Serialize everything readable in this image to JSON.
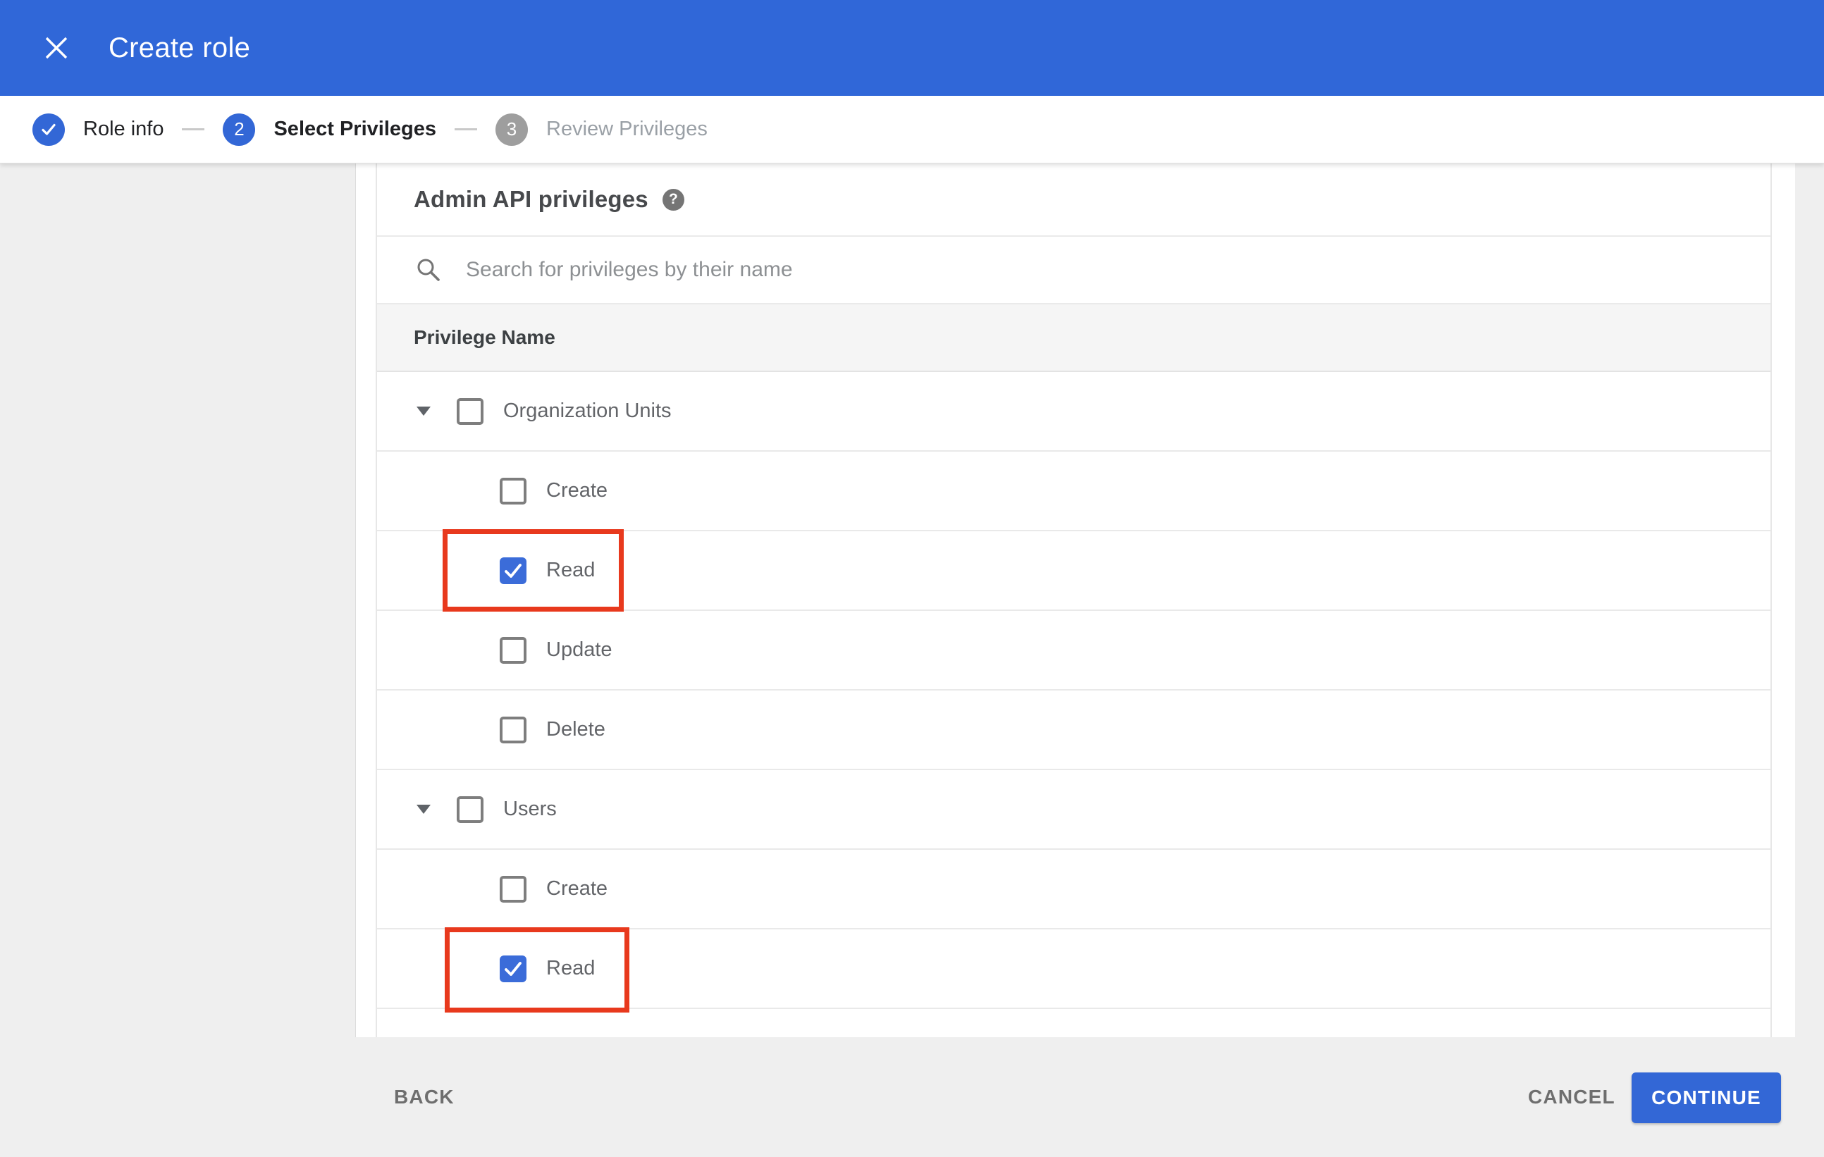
{
  "app_bar": {
    "title": "Create role",
    "close_icon": "close-icon",
    "bg_color": "#3067d8"
  },
  "stepper": {
    "steps": [
      {
        "label": "Role info",
        "indicator": "check",
        "status": "completed"
      },
      {
        "label": "Select Privileges",
        "indicator": "2",
        "status": "active"
      },
      {
        "label": "Review Privileges",
        "indicator": "3",
        "status": "upcoming"
      }
    ]
  },
  "main": {
    "section_title": "Admin API privileges",
    "help_icon": "help-icon",
    "search": {
      "icon": "search-icon",
      "placeholder": "Search for privileges by their name",
      "value": ""
    },
    "privileges_table": {
      "column_header": "Privilege Name",
      "rows": [
        {
          "label": "Organization Units",
          "type": "group",
          "checked": false,
          "expanded": true,
          "highlighted": false
        },
        {
          "label": "Create",
          "type": "child",
          "checked": false,
          "highlighted": false
        },
        {
          "label": "Read",
          "type": "child",
          "checked": true,
          "highlighted": true
        },
        {
          "label": "Update",
          "type": "child",
          "checked": false,
          "highlighted": false
        },
        {
          "label": "Delete",
          "type": "child",
          "checked": false,
          "highlighted": false
        },
        {
          "label": "Users",
          "type": "group",
          "checked": false,
          "expanded": true,
          "highlighted": false
        },
        {
          "label": "Create",
          "type": "child",
          "checked": false,
          "highlighted": false
        },
        {
          "label": "Read",
          "type": "child",
          "checked": true,
          "highlighted": true
        }
      ]
    }
  },
  "footer": {
    "back_label": "BACK",
    "cancel_label": "CANCEL",
    "continue_label": "CONTINUE"
  },
  "colors": {
    "header_blue": "#3067d8",
    "accent_blue": "#3367d6",
    "annotation_red": "#e8391d",
    "table_header_bg": "#f5f5f5",
    "page_bg": "#efefef"
  }
}
